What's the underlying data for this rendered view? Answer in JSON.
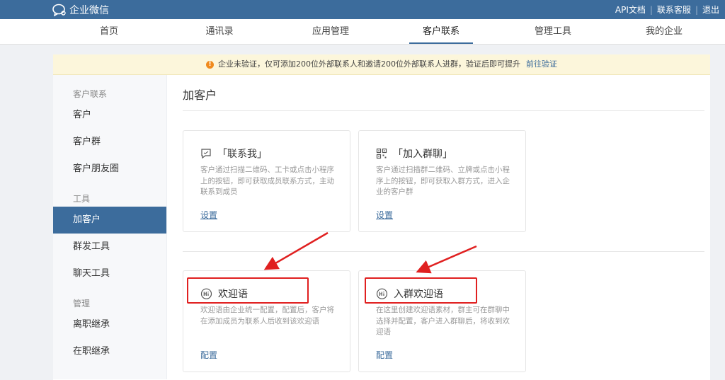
{
  "topbar": {
    "logo_text": "企业微信",
    "links": [
      "API文档",
      "联系客服",
      "退出"
    ],
    "sep": "|"
  },
  "nav": {
    "items": [
      "首页",
      "通讯录",
      "应用管理",
      "客户联系",
      "管理工具",
      "我的企业"
    ],
    "active": "客户联系"
  },
  "notice": {
    "text": "企业未验证，仅可添加200位外部联系人和邀请200位外部联系人进群，验证后即可提升",
    "link": "前往验证",
    "icon_mark": "!"
  },
  "sidebar": {
    "groups": [
      "客户联系",
      "工具",
      "管理"
    ],
    "items": [
      "客户",
      "客户群",
      "客户朋友圈",
      "加客户",
      "群发工具",
      "聊天工具",
      "离职继承",
      "在职继承"
    ],
    "active": "加客户"
  },
  "main": {
    "title": "加客户",
    "cards": [
      {
        "title": "「联系我」",
        "desc": "客户通过扫描二维码、工卡或点击小程序上的按钮，即可获取成员联系方式，主动联系到成员",
        "action": "设置",
        "icon": "message-square-icon"
      },
      {
        "title": "「加入群聊」",
        "desc": "客户通过扫描群二维码、立牌或点击小程序上的按钮，即可获取入群方式，进入企业的客户群",
        "action": "设置",
        "icon": "qrcode-icon"
      },
      {
        "title": "欢迎语",
        "desc": "欢迎语由企业统一配置，配置后，客户将在添加成员为联系人后收到该欢迎语",
        "action": "配置",
        "icon": "hi-bubble-icon"
      },
      {
        "title": "入群欢迎语",
        "desc": "在这里创建欢迎语素材，群主可在群聊中选择并配置，客户进入群聊后，将收到欢迎语",
        "action": "配置",
        "icon": "hi-bubble-icon"
      }
    ]
  },
  "colors": {
    "brand": "#3c6c9c",
    "annotation": "#e02020",
    "notice_bg": "#fcf6db"
  }
}
